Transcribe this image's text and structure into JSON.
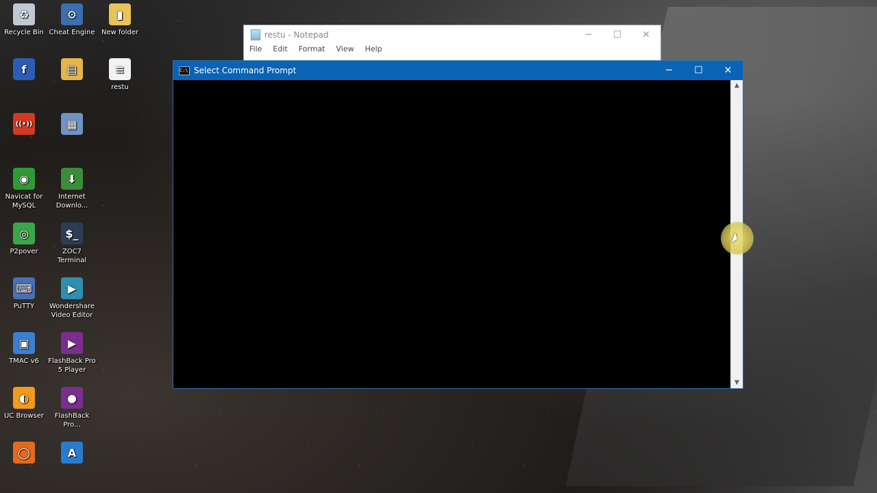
{
  "desktop": {
    "icons": [
      {
        "label": "Recycle Bin",
        "icon": "recycle-bin-icon",
        "color": "#c0c8d4",
        "glyph": "♻"
      },
      {
        "label": "Cheat Engine",
        "icon": "cheat-engine-icon",
        "color": "#3a6fb0",
        "glyph": "⚙"
      },
      {
        "label": "New folder",
        "icon": "folder-icon",
        "color": "#e8c25a",
        "glyph": "▮"
      },
      {
        "label": "",
        "icon": "facebook-icon",
        "color": "#2b5db5",
        "glyph": "f"
      },
      {
        "label": "",
        "icon": "folder-icon",
        "color": "#e3b54a",
        "glyph": "▤"
      },
      {
        "label": "restu",
        "icon": "text-file-icon",
        "color": "#f2f2f2",
        "glyph": "≡"
      },
      {
        "label": "",
        "icon": "wifi-app-icon",
        "color": "#d23a22",
        "glyph": "((•))"
      },
      {
        "label": "",
        "icon": "server-icon",
        "color": "#6f93c4",
        "glyph": "▦"
      },
      {
        "label": "Navicat for MySQL",
        "icon": "navicat-icon",
        "color": "#2f9a35",
        "glyph": "◉"
      },
      {
        "label": "Internet Downlo...",
        "icon": "internet-download-manager-icon",
        "color": "#3a8d3a",
        "glyph": "⬇"
      },
      {
        "label": "P2pover",
        "icon": "p2pover-icon",
        "color": "#3aa64a",
        "glyph": "◎"
      },
      {
        "label": "ZOC7 Terminal",
        "icon": "terminal-icon",
        "color": "#2b3e57",
        "glyph": "$_"
      },
      {
        "label": "PuTTY",
        "icon": "putty-icon",
        "color": "#4a6fb5",
        "glyph": "⌨"
      },
      {
        "label": "Wondershare Video Editor",
        "icon": "video-editor-icon",
        "color": "#2f8fb0",
        "glyph": "▶"
      },
      {
        "label": "TMAC v6",
        "icon": "tmac-icon",
        "color": "#3b7fd0",
        "glyph": "▣"
      },
      {
        "label": "FlashBack Pro 5 Player",
        "icon": "flashback-player-icon",
        "color": "#7a2f8f",
        "glyph": "▶"
      },
      {
        "label": "UC Browser",
        "icon": "uc-browser-icon",
        "color": "#f09a1e",
        "glyph": "◐"
      },
      {
        "label": "FlashBack Pro...",
        "icon": "flashback-recorder-icon",
        "color": "#7a2f8f",
        "glyph": "●"
      },
      {
        "label": "",
        "icon": "firefox-icon",
        "color": "#e46a1e",
        "glyph": "◯"
      },
      {
        "label": "",
        "icon": "app-a-icon",
        "color": "#2a7bd0",
        "glyph": "A"
      }
    ]
  },
  "notepad": {
    "title": "restu - Notepad",
    "menu": [
      "File",
      "Edit",
      "Format",
      "View",
      "Help"
    ],
    "controls": {
      "minimize": "─",
      "maximize": "☐",
      "close": "✕"
    }
  },
  "cmd": {
    "title": "Select Command Prompt",
    "icon_text": "C:\\",
    "controls": {
      "minimize": "─",
      "maximize": "☐",
      "close": "✕"
    },
    "scroll_up": "▲",
    "scroll_down": "▼"
  }
}
